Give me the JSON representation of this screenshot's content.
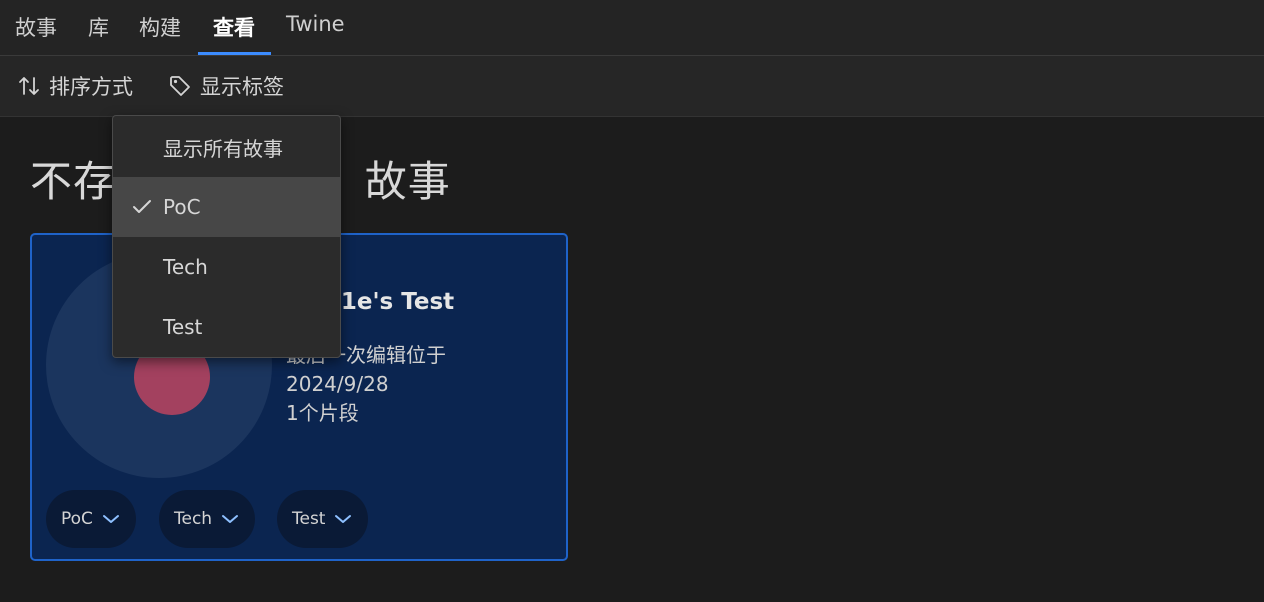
{
  "tabs": [
    {
      "label": "故事"
    },
    {
      "label": "库"
    },
    {
      "label": "构建"
    },
    {
      "label": "查看"
    },
    {
      "label": "Twine"
    }
  ],
  "active_tab": "查看",
  "toolbar": {
    "sort_label": "排序方式",
    "show_tags_label": "显示标签"
  },
  "page": {
    "title_start": "不存",
    "title_end": "故事"
  },
  "story": {
    "name_visible": "Map1e's Test",
    "edited_line_visible": "一次编辑位于",
    "edited_line_partial": "最后",
    "date": "2024/9/28",
    "passages": "1个片段",
    "tags": [
      "PoC",
      "Tech",
      "Test"
    ]
  },
  "tag_filter_menu": {
    "items": [
      {
        "label": "显示所有故事",
        "checked": false
      },
      {
        "label": "PoC",
        "checked": true
      },
      {
        "label": "Tech",
        "checked": false
      },
      {
        "label": "Test",
        "checked": false
      }
    ]
  },
  "colors": {
    "accent": "#3c8cff",
    "card_bg": "#0b2550",
    "card_border": "#1f63c9",
    "story_dot": "#a3415f"
  },
  "icons": {
    "sort": "sort-arrows-icon",
    "tag": "tag-icon",
    "check": "check-icon",
    "chevron": "chevron-down-icon"
  }
}
